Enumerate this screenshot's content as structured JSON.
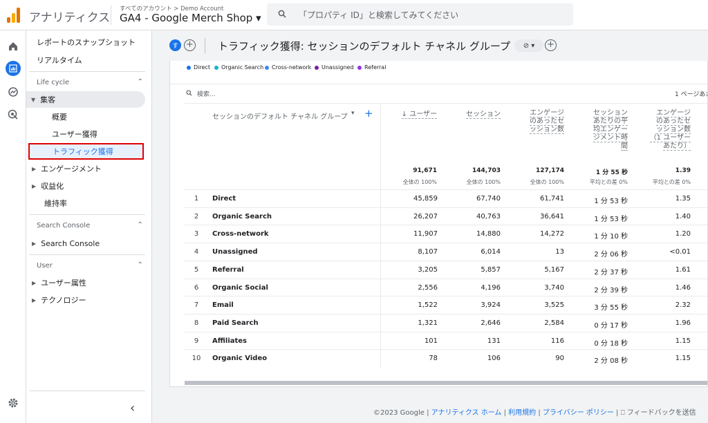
{
  "header": {
    "app_name": "アナリティクス",
    "breadcrumb": "すべてのアカウント > Demo Account",
    "property": "GA4 - Google Merch Shop ▾",
    "search_placeholder": "「プロパティ ID」と検索してみてください"
  },
  "rail_icons": [
    "home-icon",
    "reports-icon",
    "explore-icon",
    "advertising-icon",
    "settings-icon"
  ],
  "nav": {
    "snapshot": "レポートのスナップショット",
    "realtime": "リアルタイム",
    "lifecycle": "Life cycle",
    "acquisition": "集客",
    "overview": "概要",
    "user_acq": "ユーザー獲得",
    "traffic_acq": "トラフィック獲得",
    "engagement": "エンゲージメント",
    "monetization": "収益化",
    "retention": "維持率",
    "search_console_section": "Search Console",
    "search_console_item": "Search Console",
    "user_section": "User",
    "user_attr": "ユーザー属性",
    "tech": "テクノロジー",
    "collapse": "‹"
  },
  "title": {
    "avatar_letter": "す",
    "text": "トラフィック獲得: セッションのデフォルト チャネル グループ"
  },
  "legend": [
    {
      "label": "Direct",
      "color": "#1a73e8"
    },
    {
      "label": "Organic Search",
      "color": "#12b5cb"
    },
    {
      "label": "Cross-network",
      "color": "#4285f4"
    },
    {
      "label": "Unassigned",
      "color": "#7b1fa2"
    },
    {
      "label": "Referral",
      "color": "#9334e6"
    }
  ],
  "table": {
    "search_placeholder": "検索...",
    "rows_per_page": "1 ページあた",
    "dim_header": "セッションのデフォルト チャネル グループ",
    "headers": {
      "users": "↓ ユーザー",
      "sessions": "セッション",
      "engaged": [
        "エンゲージ",
        "のあったセ",
        "ッション数"
      ],
      "avg_time": [
        "セッション",
        "あたりの平",
        "均エンゲー",
        "ジメント時",
        "間"
      ],
      "per_user": [
        "エンゲージ",
        "のあったセ",
        "ッション数",
        "（1 ユーザー",
        "あたり）"
      ]
    },
    "totals": {
      "users": "91,671",
      "users_sub": "全体の 100%",
      "sessions": "144,703",
      "sessions_sub": "全体の 100%",
      "engaged": "127,174",
      "engaged_sub": "全体の 100%",
      "avg_time": "1 分 55 秒",
      "avg_time_sub": "平均との差 0%",
      "per_user": "1.39",
      "per_user_sub": "平均との差 0%"
    },
    "rows": [
      {
        "num": "1",
        "channel": "Direct",
        "users": "45,859",
        "sessions": "67,740",
        "engaged": "61,741",
        "avg_time": "1 分 53 秒",
        "per_user": "1.35"
      },
      {
        "num": "2",
        "channel": "Organic Search",
        "users": "26,207",
        "sessions": "40,763",
        "engaged": "36,641",
        "avg_time": "1 分 53 秒",
        "per_user": "1.40"
      },
      {
        "num": "3",
        "channel": "Cross-network",
        "users": "11,907",
        "sessions": "14,880",
        "engaged": "14,272",
        "avg_time": "1 分 10 秒",
        "per_user": "1.20"
      },
      {
        "num": "4",
        "channel": "Unassigned",
        "users": "8,107",
        "sessions": "6,014",
        "engaged": "13",
        "avg_time": "2 分 06 秒",
        "per_user": "<0.01"
      },
      {
        "num": "5",
        "channel": "Referral",
        "users": "3,205",
        "sessions": "5,857",
        "engaged": "5,167",
        "avg_time": "2 分 37 秒",
        "per_user": "1.61"
      },
      {
        "num": "6",
        "channel": "Organic Social",
        "users": "2,556",
        "sessions": "4,196",
        "engaged": "3,740",
        "avg_time": "2 分 39 秒",
        "per_user": "1.46"
      },
      {
        "num": "7",
        "channel": "Email",
        "users": "1,522",
        "sessions": "3,924",
        "engaged": "3,525",
        "avg_time": "3 分 55 秒",
        "per_user": "2.32"
      },
      {
        "num": "8",
        "channel": "Paid Search",
        "users": "1,321",
        "sessions": "2,646",
        "engaged": "2,584",
        "avg_time": "0 分 17 秒",
        "per_user": "1.96"
      },
      {
        "num": "9",
        "channel": "Affiliates",
        "users": "101",
        "sessions": "131",
        "engaged": "116",
        "avg_time": "0 分 18 秒",
        "per_user": "1.15"
      },
      {
        "num": "10",
        "channel": "Organic Video",
        "users": "78",
        "sessions": "106",
        "engaged": "90",
        "avg_time": "2 分 08 秒",
        "per_user": "1.15"
      }
    ]
  },
  "footer": {
    "copyright": "©2023 Google |",
    "home": "アナリティクス ホーム",
    "terms": "利用規約",
    "privacy": "プライバシー ポリシー",
    "feedback": "フィードバックを送信"
  }
}
